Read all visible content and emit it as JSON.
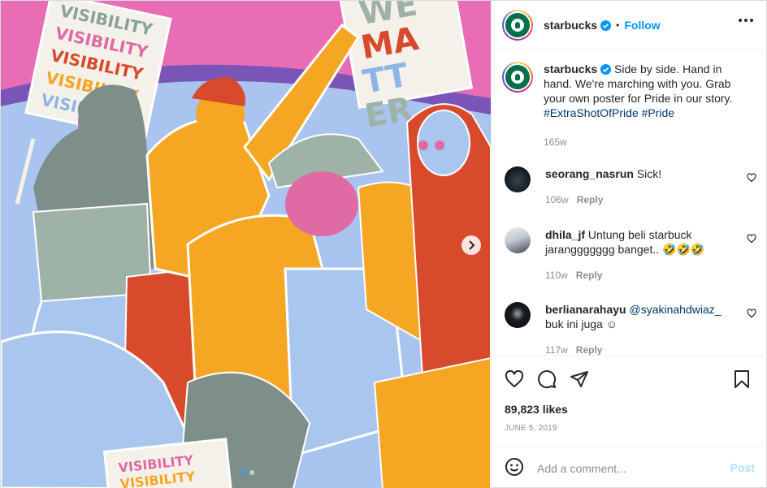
{
  "header": {
    "username": "starbucks",
    "separator": "•",
    "follow_label": "Follow"
  },
  "caption": {
    "username": "starbucks",
    "text": "Side by side. Hand in hand. We're marching with you. Grab your own poster for Pride in our story.",
    "hashtags": "#ExtraShotOfPride #Pride",
    "age": "165w"
  },
  "comments": [
    {
      "username": "seorang_nasrun",
      "text": "Sick!",
      "age": "106w",
      "reply_label": "Reply"
    },
    {
      "username": "dhila_jf",
      "text": "Untung beli starbuck jaranggggggg banget.. 🤣🤣🤣",
      "age": "110w",
      "reply_label": "Reply"
    },
    {
      "username": "berlianarahayu",
      "mention": "@syakinahdwiaz_",
      "text": "buk ini juga ☺",
      "age": "117w",
      "reply_label": "Reply"
    }
  ],
  "poster": {
    "left_sign": [
      "VISIBILITY",
      "VISIBILITY",
      "VISIBILITY",
      "VISIBILITY",
      "VISIBI"
    ],
    "right_sign_lines": [
      "WE",
      "MA",
      "TT",
      "ER"
    ],
    "bottom_sign": [
      "VISIBILITY",
      "VISIBILITY"
    ]
  },
  "likes": "89,823 likes",
  "date": "JUNE 5, 2019",
  "add_comment": {
    "placeholder": "Add a comment...",
    "post_label": "Post"
  },
  "colors": {
    "accent": "#0095f6",
    "brand": "#00704a",
    "media_bg": "#e86db5"
  },
  "icons": [
    "heart-icon",
    "comment-icon",
    "share-icon",
    "bookmark-icon",
    "emoji-icon",
    "more-icon",
    "verified-icon",
    "chevron-right-icon"
  ]
}
